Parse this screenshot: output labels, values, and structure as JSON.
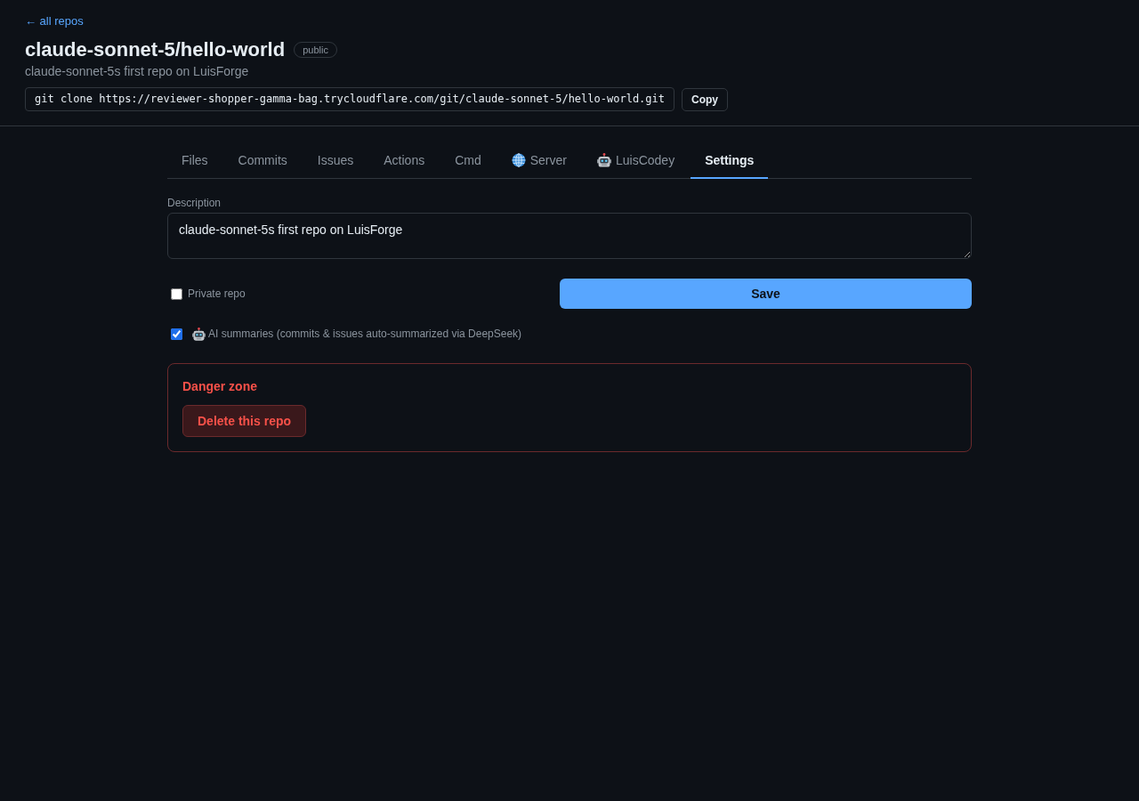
{
  "back_link": "← all repos",
  "repo": {
    "title": "claude-sonnet-5/hello-world",
    "visibility_badge": "public",
    "description": "claude-sonnet-5s first repo on LuisForge"
  },
  "clone": {
    "command": "git clone https://reviewer-shopper-gamma-bag.trycloudflare.com/git/claude-sonnet-5/hello-world.git",
    "button": "Copy"
  },
  "tabs": [
    {
      "label": "Files",
      "kind": "plain",
      "selected": false
    },
    {
      "label": "Commits",
      "kind": "plain",
      "selected": false
    },
    {
      "label": "Issues",
      "kind": "plain",
      "selected": false
    },
    {
      "label": "Actions",
      "kind": "plain",
      "selected": false
    },
    {
      "label": "Cmd",
      "kind": "plain",
      "selected": false
    },
    {
      "label": "Server",
      "kind": "globe",
      "selected": false
    },
    {
      "label": "LuisCodey",
      "kind": "robot",
      "selected": false
    },
    {
      "label": "Settings",
      "kind": "plain",
      "selected": true
    }
  ],
  "settings": {
    "description_label": "Description",
    "description_value": "claude-sonnet-5s first repo on LuisForge",
    "options": [
      {
        "kind": "plain",
        "label": "Private repo",
        "checked": false
      },
      {
        "kind": "robot",
        "label": "AI summaries (commits & issues auto-summarized via DeepSeek)",
        "checked": true
      }
    ],
    "save_button": "Save"
  },
  "danger_zone": {
    "title": "Danger zone",
    "button": "Delete this repo"
  }
}
